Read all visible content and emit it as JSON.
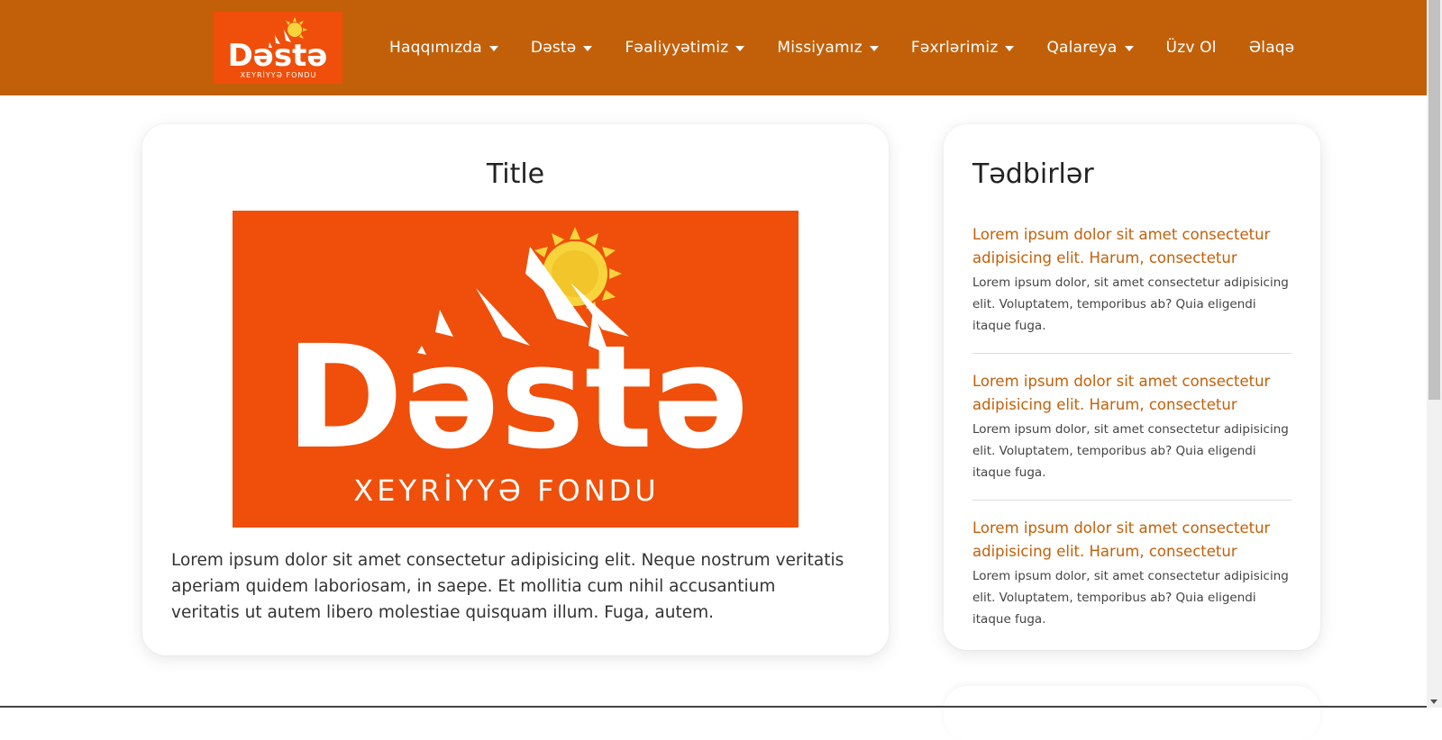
{
  "brand": {
    "logo_word": "Dəstə",
    "logo_subtitle": "XEYRİYYƏ FONDU",
    "colors": {
      "navbar": "#c2600a",
      "logo_bg": "#ef4f0a",
      "sun": "#f7d43c",
      "accent": "#c2600a"
    }
  },
  "nav": {
    "items": [
      {
        "label": "Haqqımızda",
        "dropdown": true
      },
      {
        "label": "Dəstə",
        "dropdown": true
      },
      {
        "label": "Fəaliyyətimiz",
        "dropdown": true
      },
      {
        "label": "Missiyamız",
        "dropdown": true
      },
      {
        "label": "Fəxrlərimiz",
        "dropdown": true
      },
      {
        "label": "Qalareya",
        "dropdown": true
      },
      {
        "label": "Üzv Ol",
        "dropdown": false
      },
      {
        "label": "Əlaqə",
        "dropdown": false
      }
    ]
  },
  "main": {
    "title": "Title",
    "image_word": "Dəstə",
    "image_subtitle": "XEYRİYYƏ FONDU",
    "text": "Lorem ipsum dolor sit amet consectetur adipisicing elit. Neque nostrum veritatis aperiam quidem laboriosam, in saepe. Et mollitia cum nihil accusantium veritatis ut autem libero molestiae quisquam illum. Fuga, autem."
  },
  "sidebar": {
    "title": "Tədbirlər",
    "events": [
      {
        "title": "Lorem ipsum dolor sit amet consectetur adipisicing elit. Harum, consectetur",
        "text": "Lorem ipsum dolor, sit amet consectetur adipisicing elit. Voluptatem, temporibus ab? Quia eligendi itaque fuga."
      },
      {
        "title": "Lorem ipsum dolor sit amet consectetur adipisicing elit. Harum, consectetur",
        "text": "Lorem ipsum dolor, sit amet consectetur adipisicing elit. Voluptatem, temporibus ab? Quia eligendi itaque fuga."
      },
      {
        "title": "Lorem ipsum dolor sit amet consectetur adipisicing elit. Harum, consectetur",
        "text": "Lorem ipsum dolor, sit amet consectetur adipisicing elit. Voluptatem, temporibus ab? Quia eligendi itaque fuga."
      }
    ]
  }
}
